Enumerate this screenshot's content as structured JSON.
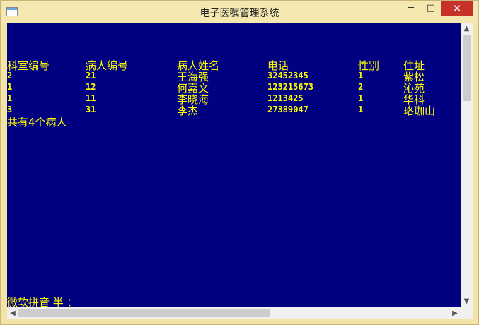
{
  "window": {
    "title": "电子医嘱管理系统",
    "icon": "console-window-icon",
    "controls": {
      "minimize": "─",
      "maximize": "□",
      "close": "✕"
    }
  },
  "console": {
    "background": "#000080",
    "text_color": "#ffff00",
    "headers": [
      "科室编号",
      "病人编号",
      "病人姓名",
      "电话",
      "性别",
      "住址"
    ],
    "rows": [
      [
        "2",
        "21",
        "王海强",
        "32452345",
        "1",
        "紫松"
      ],
      [
        "1",
        "12",
        "何嘉文",
        "123215673",
        "2",
        "沁苑"
      ],
      [
        "1",
        "11",
        "李晓海",
        "1213425",
        "1",
        "华科"
      ],
      [
        "3",
        "31",
        "李杰",
        "27389047",
        "1",
        "珞珈山"
      ]
    ],
    "summary": "共有4个病人",
    "ime_status": "微软拼音 半 ："
  },
  "scrollbars": {
    "up": "▲",
    "down": "▼",
    "left": "◀",
    "right": "▶"
  }
}
